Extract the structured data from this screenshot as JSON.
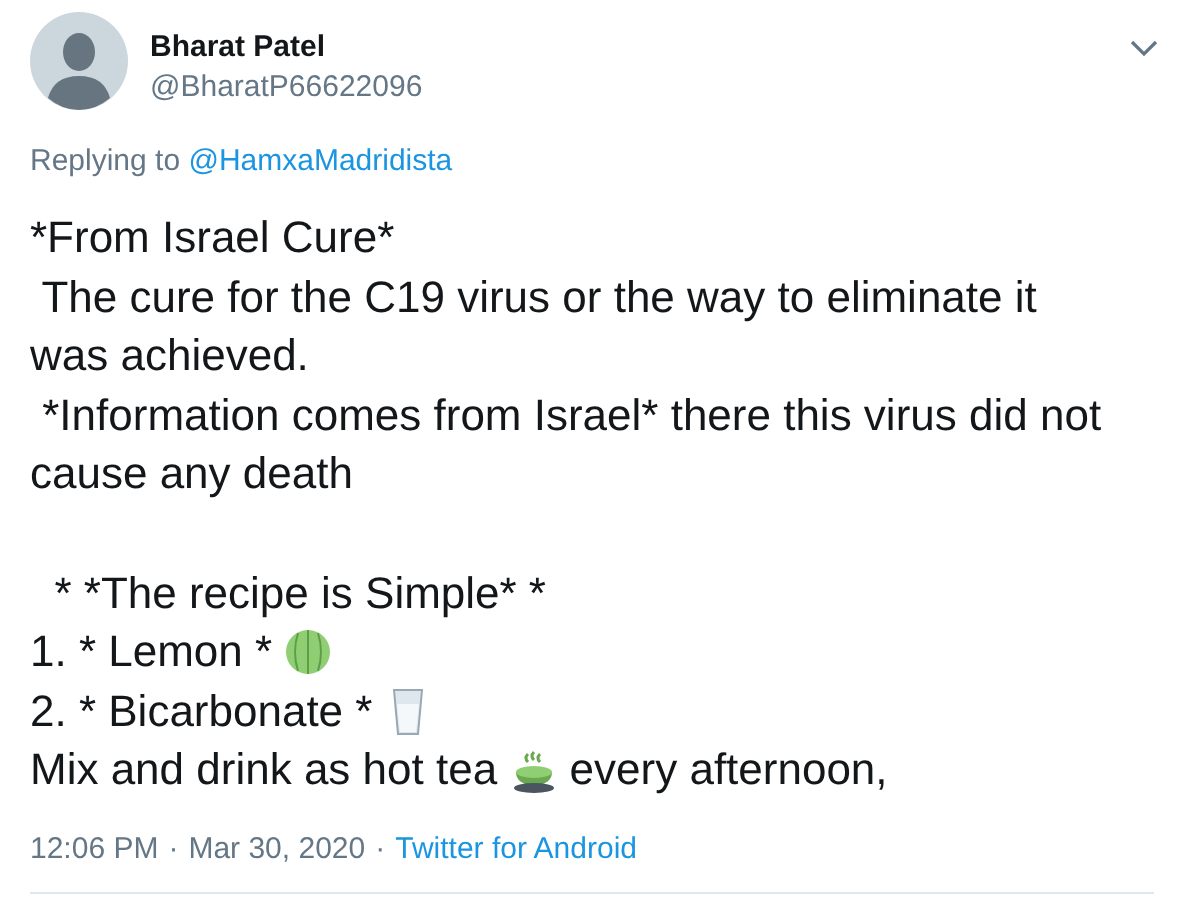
{
  "author": {
    "name": "Bharat Patel",
    "handle": "@BharatP66622096"
  },
  "reply": {
    "prefix": "Replying to",
    "mention": "@HamxaMadridista"
  },
  "paragraphs": [
    [
      {
        "kind": "plain",
        "text": "*From Israel Cure*"
      },
      {
        "kind": "plain",
        "text": " The cure for the C19 virus or the way to eliminate it"
      },
      {
        "kind": "plain",
        "text": "was achieved."
      },
      {
        "kind": "plain",
        "text": " *Information comes from Israel* there this virus did not"
      },
      {
        "kind": "plain",
        "text": "cause any death"
      }
    ],
    [
      {
        "kind": "plain",
        "text": "  * *The recipe is Simple* *"
      },
      {
        "kind": "melon",
        "text": "1. * Lemon * "
      },
      {
        "kind": "glass",
        "text": "2. * Bicarbonate * "
      },
      {
        "kind": "tea",
        "text": "Mix and drink as hot tea ",
        "after": " every afternoon,"
      }
    ]
  ],
  "meta": {
    "time": "12:06 PM",
    "separator": "·",
    "date": "Mar 30, 2020",
    "separator2": "·",
    "source": "Twitter for Android"
  }
}
